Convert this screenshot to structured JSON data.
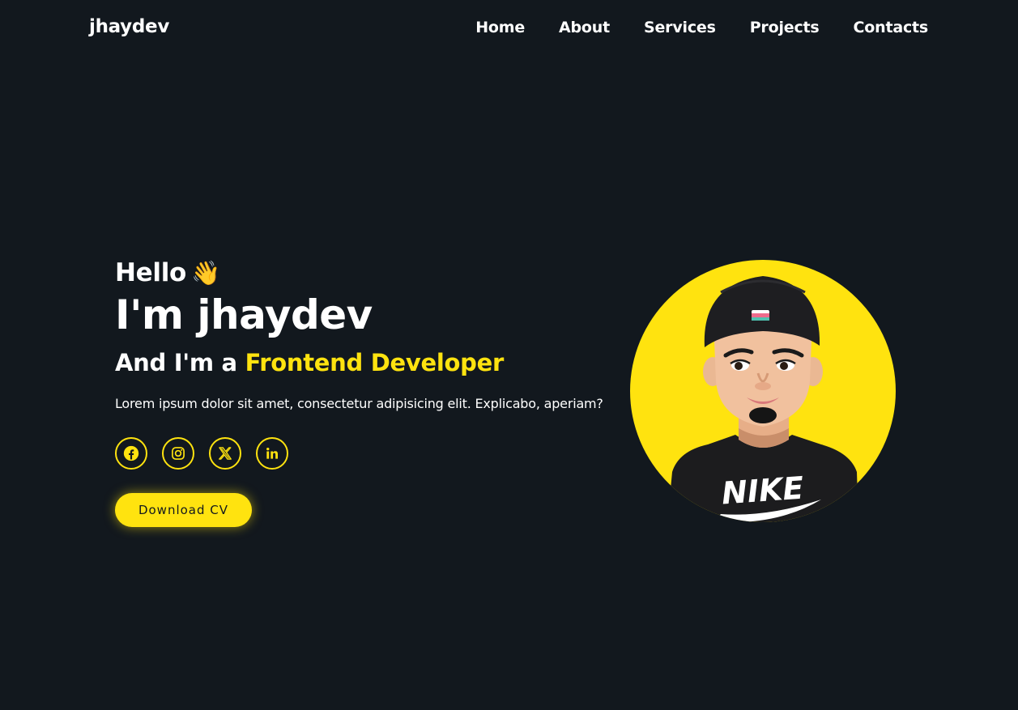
{
  "header": {
    "logo": "jhaydev",
    "nav": [
      {
        "label": "Home"
      },
      {
        "label": "About"
      },
      {
        "label": "Services"
      },
      {
        "label": "Projects"
      },
      {
        "label": "Contacts"
      }
    ]
  },
  "hero": {
    "greeting": "Hello",
    "greeting_emoji": "👋",
    "name": "I'm jhaydev",
    "role_prefix": "And I'm a",
    "role_highlight": "Frontend Developer",
    "description": "Lorem ipsum dolor sit amet, consectetur adipisicing elit. Explicabo, aperiam?",
    "socials": [
      {
        "icon": "facebook-icon"
      },
      {
        "icon": "instagram-icon"
      },
      {
        "icon": "x-twitter-icon"
      },
      {
        "icon": "linkedin-icon"
      }
    ],
    "cta_label": "Download CV",
    "avatar": {
      "shirt_text": "NIKE"
    }
  },
  "colors": {
    "background": "#12181e",
    "accent": "#ffe30f",
    "text": "#ffffff"
  }
}
